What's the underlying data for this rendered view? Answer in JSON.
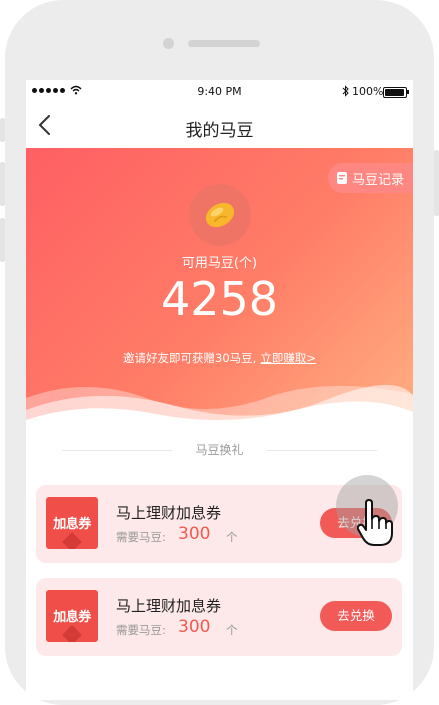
{
  "status_bar": {
    "time": "9:40 PM",
    "battery": "100%"
  },
  "nav": {
    "title": "我的马豆"
  },
  "hero": {
    "record_label": "马豆记录",
    "available_label": "可用马豆(个)",
    "bean_count": "4258",
    "invite_text": "邀请好友即可获赠30马豆,",
    "invite_link": "立即赚取>"
  },
  "section": {
    "title": "马豆换礼"
  },
  "cards": [
    {
      "coupon_label": "加息券",
      "title": "马上理财加息券",
      "need_label": "需要马豆:",
      "price": "300",
      "unit": "个",
      "button": "去兑换"
    },
    {
      "coupon_label": "加息券",
      "title": "马上理财加息券",
      "need_label": "需要马豆:",
      "price": "300",
      "unit": "个",
      "button": "去兑换"
    }
  ],
  "colors": {
    "accent": "#f25a58",
    "hero_start": "#ff5f63",
    "hero_end": "#ffb183",
    "card_bg": "#fde9e9"
  }
}
